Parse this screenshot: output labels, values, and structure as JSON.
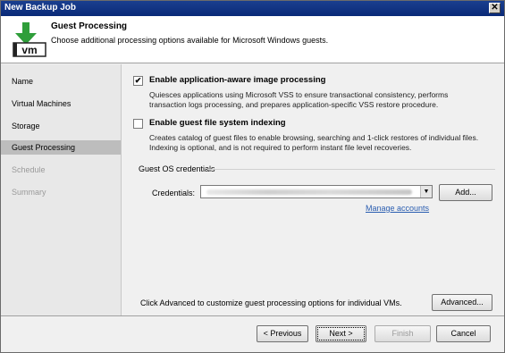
{
  "window": {
    "title": "New Backup Job",
    "close_glyph": "✕"
  },
  "header": {
    "icon": "vm-download-icon",
    "icon_text": "vm",
    "title": "Guest Processing",
    "description": "Choose additional processing options available for Microsoft Windows guests."
  },
  "sidebar": {
    "items": [
      {
        "label": "Name",
        "state": "normal"
      },
      {
        "label": "Virtual Machines",
        "state": "normal"
      },
      {
        "label": "Storage",
        "state": "normal"
      },
      {
        "label": "Guest Processing",
        "state": "active"
      },
      {
        "label": "Schedule",
        "state": "disabled"
      },
      {
        "label": "Summary",
        "state": "disabled"
      }
    ]
  },
  "options": {
    "app_aware": {
      "label": "Enable application-aware image processing",
      "checked": true,
      "check_glyph": "✔",
      "description_line1": "Quiesces applications using Microsoft VSS to ensure transactional consistency, performs",
      "description_line2": "transaction logs processing, and prepares application-specific VSS restore procedure."
    },
    "indexing": {
      "label": "Enable guest file system indexing",
      "checked": false,
      "description_line1": "Creates catalog of guest files to enable browsing, searching and 1-click restores of individual files.",
      "description_line2": "Indexing is optional, and is not required to perform instant file level recoveries."
    }
  },
  "credentials": {
    "group_title": "Guest OS credentials",
    "label": "Credentials:",
    "arrow_glyph": "▼",
    "add_label": "Add...",
    "manage_link": "Manage accounts"
  },
  "advanced": {
    "hint": "Click Advanced to customize guest processing options for individual VMs.",
    "button_label": "Advanced..."
  },
  "footer": {
    "previous_label": "< Previous",
    "next_label": "Next >",
    "finish_label": "Finish",
    "cancel_label": "Cancel"
  }
}
